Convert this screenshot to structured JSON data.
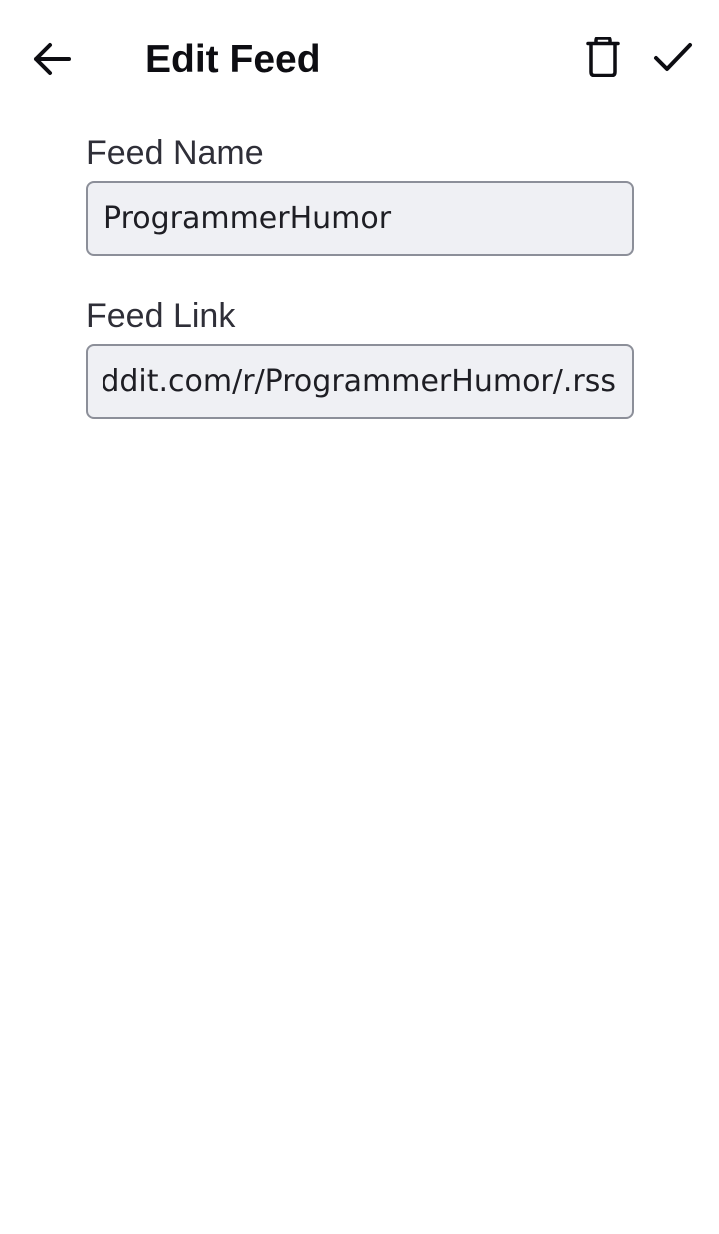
{
  "header": {
    "title": "Edit Feed",
    "back_icon": "arrow-left-icon",
    "delete_icon": "trash-icon",
    "save_icon": "check-icon"
  },
  "form": {
    "feed_name": {
      "label": "Feed Name",
      "value": "ProgrammerHumor"
    },
    "feed_link": {
      "label": "Feed Link",
      "value": "https://www.reddit.com/r/ProgrammerHumor/.rss"
    }
  },
  "colors": {
    "input_background": "#eff0f4",
    "input_border": "#8c8f99",
    "title_color": "#0d0d12",
    "label_color": "#2f2f38"
  }
}
